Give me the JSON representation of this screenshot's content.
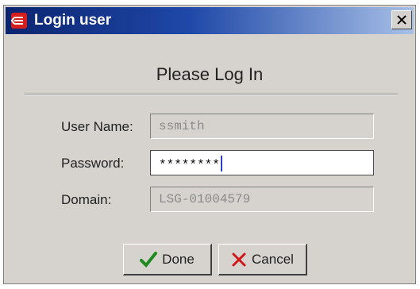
{
  "window": {
    "title": "Login user",
    "icon": "red-stacked-logo-icon",
    "close_glyph": "✕"
  },
  "dialog": {
    "heading": "Please Log In",
    "fields": {
      "username": {
        "label": "User Name:",
        "value": "ssmith",
        "enabled": false
      },
      "password": {
        "label": "Password:",
        "value": "********",
        "enabled": true
      },
      "domain": {
        "label": "Domain:",
        "value": "LSG-01004579",
        "enabled": false
      }
    },
    "buttons": {
      "done": {
        "label": "Done",
        "icon": "green-check-icon"
      },
      "cancel": {
        "label": "Cancel",
        "icon": "red-x-icon"
      }
    }
  },
  "colors": {
    "titlebar_start": "#0b2470",
    "titlebar_end": "#a8c0e6",
    "dialog_bg": "#d6d3ce",
    "check_green": "#1f8a1f",
    "cancel_red": "#d01818"
  }
}
